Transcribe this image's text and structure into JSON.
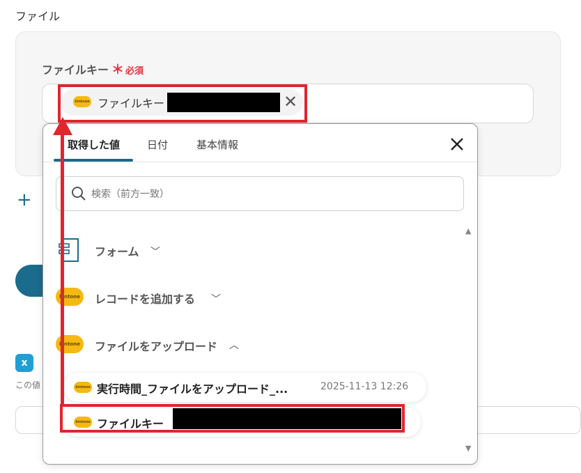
{
  "section": {
    "title": "ファイル"
  },
  "field": {
    "label": "ファイルキー",
    "required_star": "＊",
    "required_text": "必須",
    "chip_label": "ファイルキー"
  },
  "popup": {
    "tabs": [
      "取得した値",
      "日付",
      "基本情報"
    ],
    "active_tab": "取得した値",
    "search_placeholder": "検索（前方一致）",
    "groups": [
      {
        "label": "フォーム",
        "expanded": false,
        "icon": "form-icon"
      },
      {
        "label": "レコードを追加する",
        "expanded": false,
        "icon": "kintone-icon"
      },
      {
        "label": "ファイルをアップロード",
        "expanded": true,
        "icon": "kintone-icon"
      }
    ],
    "items": [
      {
        "label": "実行時間_ファイルをアップロード_...",
        "date": "2025-11-13 12:26"
      },
      {
        "label": "ファイルキー",
        "date": ""
      }
    ],
    "badge_text": "kintone"
  },
  "background": {
    "note": "この値"
  },
  "colors": {
    "accent": "#1b6b8c",
    "highlight": "#e0262d",
    "kintone": "#f5b913",
    "required": "#e0343c"
  }
}
